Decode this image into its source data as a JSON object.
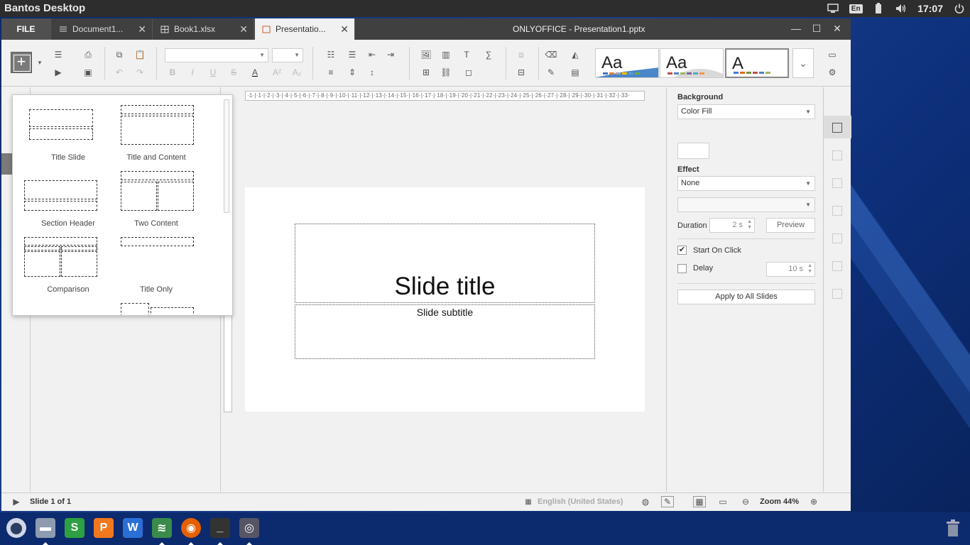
{
  "desktop": {
    "title": "Bantos Desktop",
    "keyboard_layout": "En",
    "clock": "17:07",
    "icons": [
      "display-icon",
      "battery-icon",
      "volume-icon",
      "power-icon"
    ]
  },
  "window": {
    "file_tab": "FILE",
    "tabs": [
      {
        "label": "Document1...",
        "icon": "document-icon",
        "color": "#446995"
      },
      {
        "label": "Book1.xlsx",
        "icon": "spreadsheet-icon",
        "color": "#40865c"
      },
      {
        "label": "Presentatio...",
        "icon": "presentation-icon",
        "color": "#aa5252",
        "active": true
      }
    ],
    "title": "ONLYOFFICE - Presentation1.pptx",
    "controls": {
      "minimize": "—",
      "maximize": "☐",
      "close": "✕"
    }
  },
  "toolbar": {
    "font_name": "",
    "font_size": "",
    "themes": [
      {
        "label": "Aa",
        "colors": [
          "#4472c4",
          "#ed7d31",
          "#a5a5a5",
          "#ffc000",
          "#5b9bd5",
          "#70ad47"
        ]
      },
      {
        "label": "Aa",
        "colors": [
          "#c0504d",
          "#4f81bd",
          "#9bbb59",
          "#8064a2",
          "#4bacc6",
          "#f79646"
        ]
      },
      {
        "label": "A",
        "colors": [
          "#3b7dd8",
          "#e36c0a",
          "#76923c",
          "#c0504d",
          "#4f81bd",
          "#9bbb59"
        ]
      }
    ],
    "more_themes": "⌄"
  },
  "layout_menu": {
    "items": [
      {
        "label": "Title Slide"
      },
      {
        "label": "Title and Content"
      },
      {
        "label": "Section Header"
      },
      {
        "label": "Two Content"
      },
      {
        "label": "Comparison"
      },
      {
        "label": "Title Only"
      }
    ]
  },
  "slide": {
    "title": "Slide title",
    "subtitle": "Slide subtitle",
    "ruler_text": "·1·|·1·|·2·|·3·|·4·|·5·|·6·|·7·|·8·|·9·|·10·|·11·|·12·|·13·|·14·|·15·|·16·|·17·|·18·|·19·|·20·|·21·|·22·|·23·|·24·|·25·|·26·|·27·|·28·|·29·|·30·|·31·|·32·|·33·"
  },
  "right_panel": {
    "background_label": "Background",
    "background_fill": "Color Fill",
    "effect_label": "Effect",
    "effect_value": "None",
    "effect_type": "",
    "duration_label": "Duration",
    "duration_value": "2 s",
    "preview_button": "Preview",
    "start_on_click_label": "Start On Click",
    "start_on_click_checked": true,
    "delay_label": "Delay",
    "delay_checked": false,
    "delay_value": "10 s",
    "apply_all_button": "Apply to All Slides"
  },
  "statusbar": {
    "slide_counter": "Slide 1 of 1",
    "language": "English (United States)",
    "zoom": "Zoom 44%"
  },
  "taskbar": {
    "apps": [
      "launcher-icon",
      "files-icon",
      "spreadsheet-app-icon",
      "presentation-app-icon",
      "writer-app-icon",
      "onlyoffice-icon",
      "firefox-icon",
      "terminal-icon",
      "screenshot-icon"
    ],
    "trash_icon": "trash-icon"
  }
}
